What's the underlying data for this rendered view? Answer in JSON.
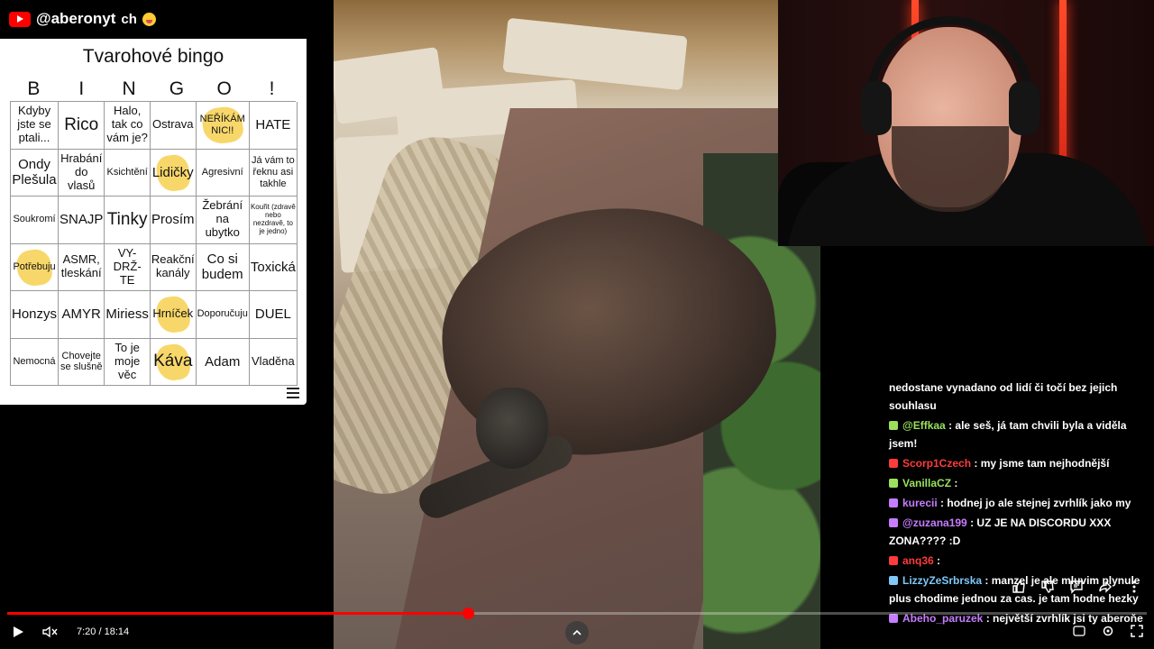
{
  "channel": {
    "handle": "@aberonyt",
    "suffix": "ch"
  },
  "bingo": {
    "title": "Tvarohové bingo",
    "letters": [
      "B",
      "I",
      "N",
      "G",
      "O",
      "!"
    ],
    "cells": [
      [
        "Kdyby jste se ptali...",
        "Rico",
        "Halo, tak co vám je?",
        "Ostrava",
        "NEŘÍKÁM NIC!!",
        "HATE"
      ],
      [
        "Ondy Plešula",
        "Hrabání do vlasů",
        "Ksichtění",
        "Lidičky",
        "Agresivní",
        "Já vám to řeknu asi takhle"
      ],
      [
        "Soukromí",
        "SNAJP",
        "Tinky",
        "Prosím",
        "Žebrání na ubytko",
        "Kouřit (zdravě nebo nezdravě, to je jedno)"
      ],
      [
        "Potřebuju",
        "ASMR, tleskání",
        "VY-DRŽ-TE",
        "Reakční kanály",
        "Co si budem",
        "Toxická"
      ],
      [
        "Honzys",
        "AMYR",
        "Miriess",
        "Hrníček",
        "Doporučuju",
        "DUEL"
      ],
      [
        "Nemocná",
        "Chovejte se slušně",
        "To je moje věc",
        "Káva",
        "Adam",
        "Vladěna"
      ]
    ],
    "marked": [
      [
        0,
        4
      ],
      [
        1,
        3
      ],
      [
        3,
        0
      ],
      [
        4,
        3
      ],
      [
        5,
        3
      ]
    ]
  },
  "chat": [
    {
      "author": "",
      "text": "nedostane vynadano od lidí či točí bez jejich souhlasu",
      "color": "#ffffff"
    },
    {
      "author": "@Effkaa",
      "text": ": ale seš, já tam chvili byla a viděla jsem!",
      "color": "#9be15d"
    },
    {
      "author": "Scorp1Czech",
      "text": ": my jsme tam nejhodnější",
      "color": "#ff3b3b"
    },
    {
      "author": "VanillaCZ",
      "text": ":",
      "color": "#9be15d"
    },
    {
      "author": "kurecii",
      "text": ": hodnej jo ale stejnej zvrhlík jako my",
      "color": "#c77dff"
    },
    {
      "author": "@zuzana199",
      "text": ": UZ JE NA DISCORDU XXX ZONA???? :D",
      "color": "#c77dff"
    },
    {
      "author": "anq36",
      "text": ":",
      "color": "#ff3b3b"
    },
    {
      "author": "LizzyZeSrbrska",
      "text": ": manzel je ale mluvim plynule plus chodime jednou za cas. je tam hodne hezky",
      "color": "#7fc8f8"
    },
    {
      "author": "Abeho_paruzek",
      "text": ": největší zvrhlík jsi ty aberoňe",
      "color": "#c77dff"
    }
  ],
  "player": {
    "time": "7:20 / 18:14",
    "progress": 0.404
  },
  "icons": [
    "youtube-logo-icon",
    "menu-icon",
    "play-icon",
    "mute-icon",
    "chevron-up-icon",
    "like-icon",
    "dislike-icon",
    "comment-icon",
    "share-icon",
    "more-icon",
    "captions-icon",
    "settings-icon",
    "fullscreen-icon"
  ]
}
